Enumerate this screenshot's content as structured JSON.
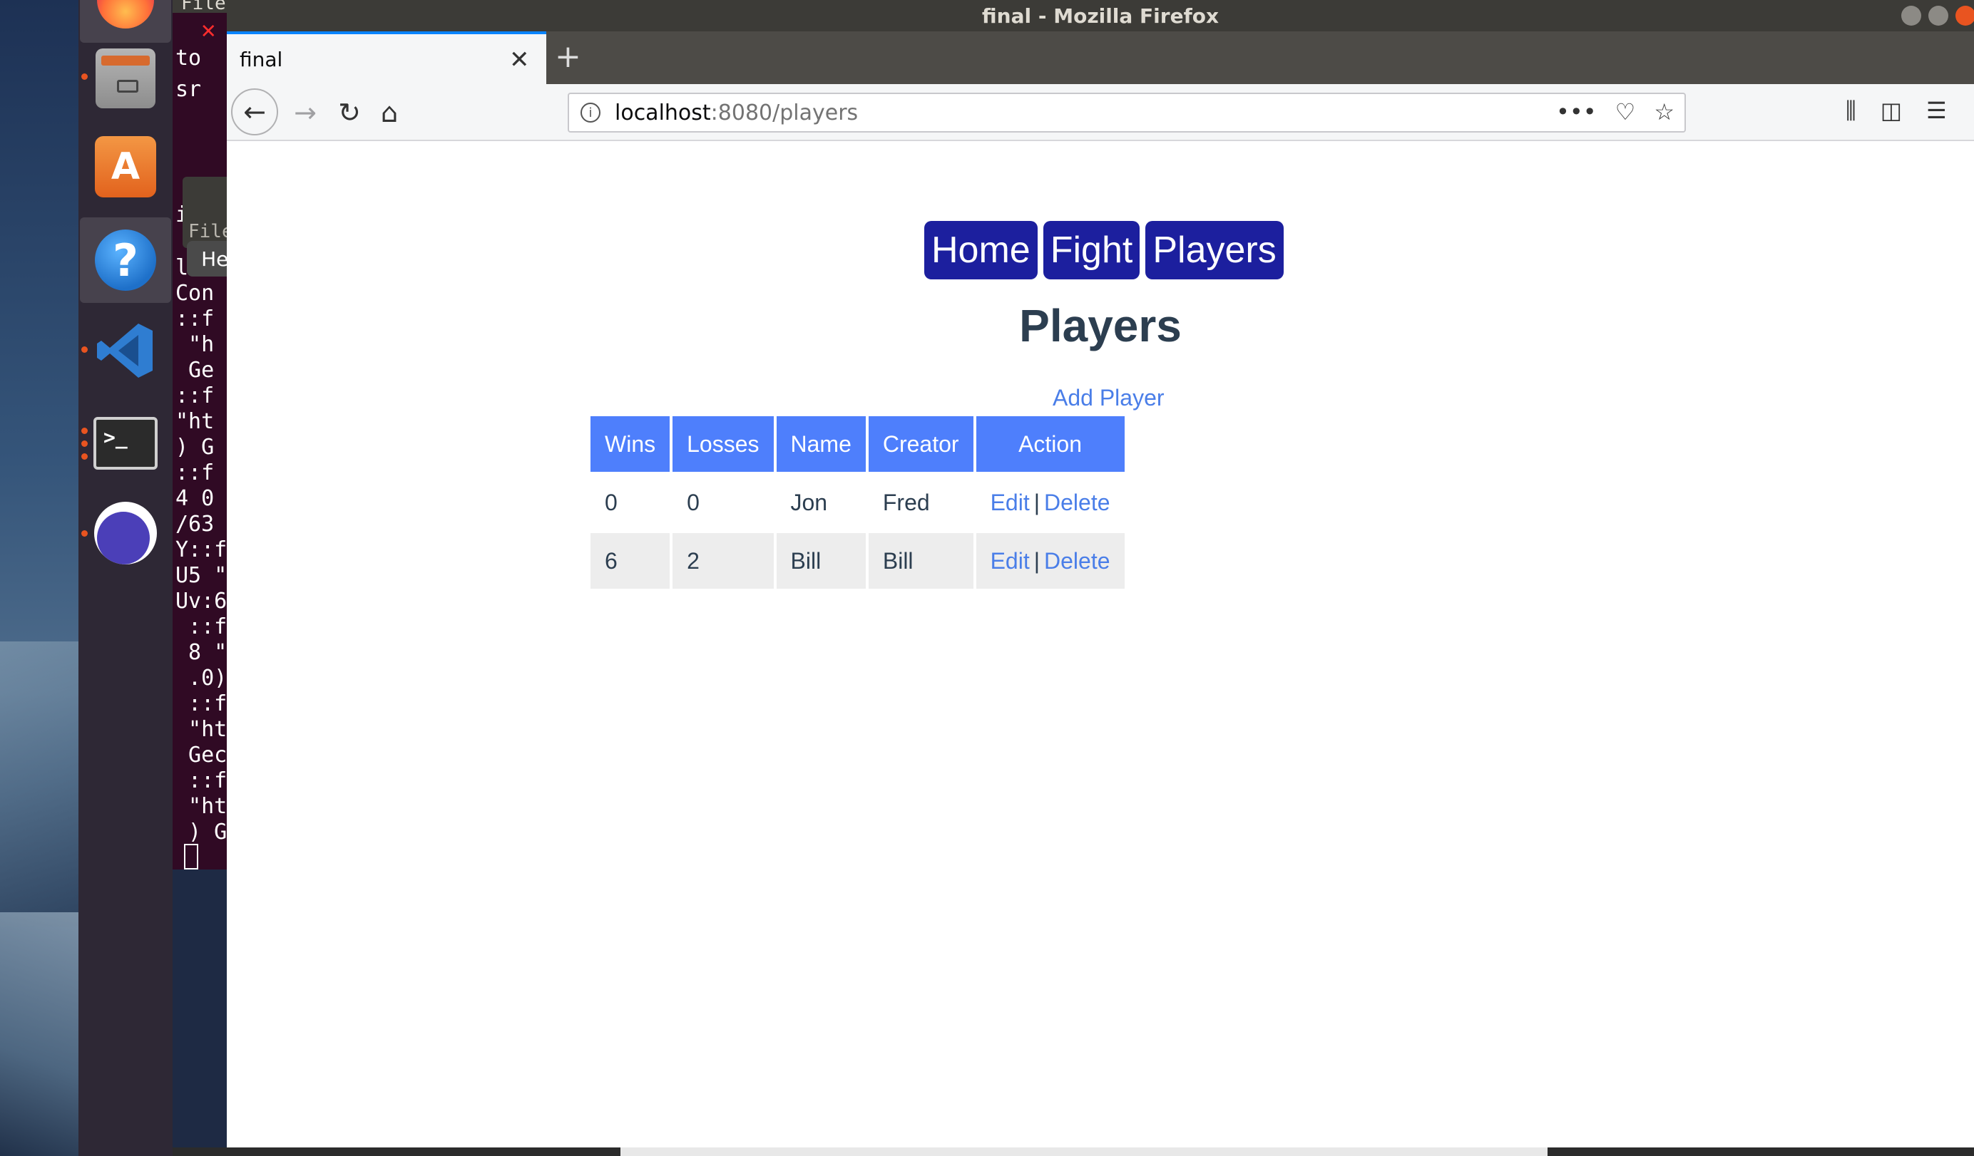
{
  "window": {
    "title": "final - Mozilla Firefox"
  },
  "tab": {
    "title": "final"
  },
  "urlbar": {
    "host": "localhost",
    "path": ":8080/players"
  },
  "terminal": {
    "menu_file": "File",
    "lines": [
      "to",
      "sr",
      "i",
      "lPa",
      "Con",
      "::f",
      " \"h",
      " Ge",
      "::f",
      "\"ht",
      ") G",
      "::f",
      "4 0",
      "/63",
      "Y::f",
      "U5 \"",
      "Uv:6",
      " ::f",
      " 8 \"",
      " .0)",
      " ::f",
      " \"ht",
      " Gec",
      " ::f",
      " \"ht",
      " ) G"
    ],
    "file_label": "File"
  },
  "tooltip": {
    "help": "Help"
  },
  "nav": {
    "home": "Home",
    "fight": "Fight",
    "players": "Players"
  },
  "page": {
    "title": "Players",
    "add_player": "Add Player"
  },
  "table": {
    "headers": [
      "Wins",
      "Losses",
      "Name",
      "Creator",
      "Action"
    ],
    "rows": [
      {
        "wins": "0",
        "losses": "0",
        "name": "Jon",
        "creator": "Fred",
        "edit": "Edit",
        "sep": "|",
        "delete": "Delete"
      },
      {
        "wins": "6",
        "losses": "2",
        "name": "Bill",
        "creator": "Bill",
        "edit": "Edit",
        "sep": "|",
        "delete": "Delete"
      }
    ]
  },
  "icons": {
    "dock": [
      "firefox-icon",
      "files-icon",
      "software-center-icon",
      "help-icon",
      "vscode-icon",
      "terminal-icon",
      "eclipse-icon"
    ]
  },
  "colors": {
    "nav_button": "#1c1f9e",
    "table_header": "#4e7ffc",
    "link": "#4a7ee8",
    "heading": "#2c3e50"
  }
}
